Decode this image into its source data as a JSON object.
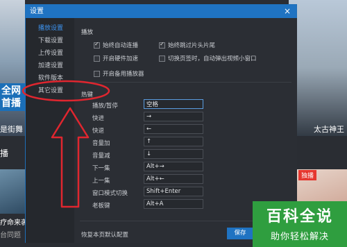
{
  "background": {
    "left_badge": "全网首播",
    "left_caption": "是街舞",
    "left_section": "播",
    "left_card_title": "疗命来袭",
    "left_card_sub": "台同题",
    "right_caption": "太古神王",
    "right_tag": "独播"
  },
  "dialog": {
    "title": "设置",
    "close_icon": "×"
  },
  "sidebar": {
    "items": [
      {
        "label": "播放设置",
        "active": true
      },
      {
        "label": "下载设置",
        "active": false
      },
      {
        "label": "上传设置",
        "active": false
      },
      {
        "label": "加速设置",
        "active": false
      },
      {
        "label": "软件版本",
        "active": false
      },
      {
        "label": "其它设置",
        "active": false
      }
    ]
  },
  "playback": {
    "section_title": "播放",
    "options": [
      {
        "label": "始终自动连播",
        "checked": true
      },
      {
        "label": "始终跳过片头片尾",
        "checked": true
      },
      {
        "label": "开启硬件加速",
        "checked": false
      },
      {
        "label": "切换页签时，自动弹出视频小窗口",
        "checked": false
      },
      {
        "label": "开启备用播放器",
        "checked": false
      }
    ]
  },
  "hotkeys": {
    "section_title": "热键",
    "items": [
      {
        "label": "播放/暂停",
        "value": "空格"
      },
      {
        "label": "快进",
        "value": "→"
      },
      {
        "label": "快退",
        "value": "←"
      },
      {
        "label": "音量加",
        "value": "↑"
      },
      {
        "label": "音量减",
        "value": "↓"
      },
      {
        "label": "下一集",
        "value": "Alt+→"
      },
      {
        "label": "上一集",
        "value": "Alt+←"
      },
      {
        "label": "窗口模式切换",
        "value": "Shift+Enter"
      },
      {
        "label": "老板键",
        "value": "Alt+A"
      }
    ]
  },
  "footer": {
    "restore_label": "恢复本页默认配置",
    "save_label": "保存"
  },
  "watermark": {
    "line1": "百科全说",
    "line2": "助你轻松解决"
  },
  "colors": {
    "accent": "#1f73c2",
    "annotation": "#e0262f",
    "watermark": "#2f9e3f"
  }
}
